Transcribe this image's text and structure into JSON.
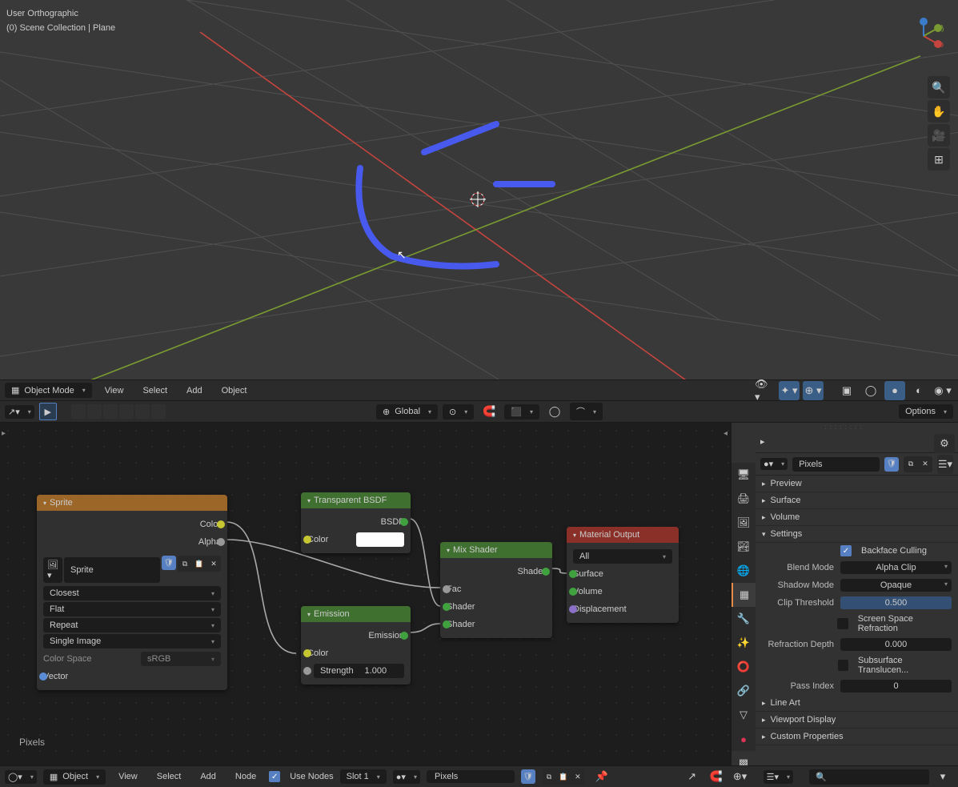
{
  "viewport": {
    "view_label": "User Orthographic",
    "collection_label": "(0) Scene Collection | Plane"
  },
  "toolbar": {
    "mode": "Object Mode",
    "menus": [
      "View",
      "Select",
      "Add",
      "Object"
    ],
    "orientation": "Global",
    "options": "Options"
  },
  "nodes": {
    "sprite": {
      "title": "Sprite",
      "outputs": [
        "Color",
        "Alpha"
      ],
      "image_name": "Sprite",
      "interp": "Closest",
      "projection": "Flat",
      "extension": "Repeat",
      "source": "Single Image",
      "colorspace_label": "Color Space",
      "colorspace_value": "sRGB",
      "vector": "Vector"
    },
    "transparent": {
      "title": "Transparent BSDF",
      "output": "BSDF",
      "color_label": "Color"
    },
    "emission": {
      "title": "Emission",
      "output": "Emission",
      "color_label": "Color",
      "strength_label": "Strength",
      "strength_value": "1.000"
    },
    "mix": {
      "title": "Mix Shader",
      "output": "Shader",
      "fac": "Fac",
      "shader1": "Shader",
      "shader2": "Shader"
    },
    "matout": {
      "title": "Material Output",
      "target": "All",
      "surface": "Surface",
      "volume": "Volume",
      "displacement": "Displacement"
    }
  },
  "material_name": "Pixels",
  "properties": {
    "material": "Pixels",
    "sections": {
      "preview": "Preview",
      "surface": "Surface",
      "volume": "Volume",
      "settings": "Settings",
      "lineart": "Line Art",
      "viewport": "Viewport Display",
      "custom": "Custom Properties"
    },
    "settings": {
      "backface_label": "Backface Culling",
      "backface_on": true,
      "blend_mode_label": "Blend Mode",
      "blend_mode": "Alpha Clip",
      "shadow_mode_label": "Shadow Mode",
      "shadow_mode": "Opaque",
      "clip_thresh_label": "Clip Threshold",
      "clip_thresh": "0.500",
      "ssr_label": "Screen Space Refraction",
      "refraction_depth_label": "Refraction Depth",
      "refraction_depth": "0.000",
      "sss_label": "Subsurface Translucen...",
      "pass_index_label": "Pass Index",
      "pass_index": "0"
    }
  },
  "bottom": {
    "mode": "Object",
    "menus": [
      "View",
      "Select",
      "Add",
      "Node"
    ],
    "use_nodes": "Use Nodes",
    "slot": "Slot 1",
    "material": "Pixels"
  }
}
